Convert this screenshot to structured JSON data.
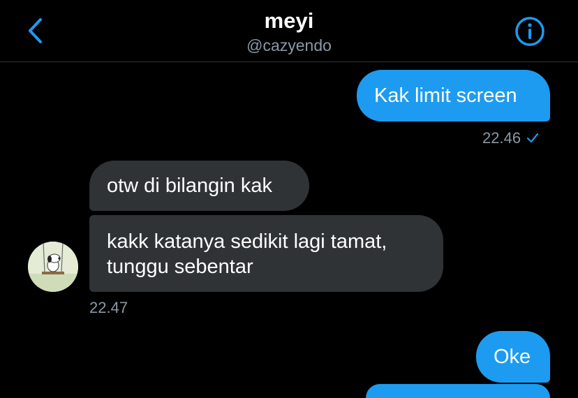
{
  "header": {
    "title": "meyi",
    "handle": "@cazyendo"
  },
  "colors": {
    "background": "#000000",
    "sent_bubble": "#1d9bf0",
    "received_bubble": "#2f3336",
    "accent": "#1d9bf0",
    "muted_text": "#8b98a5"
  },
  "icons": {
    "back": "chevron-left-icon",
    "info": "info-circle-icon",
    "read_receipt": "checkmark-icon"
  },
  "messages": [
    {
      "direction": "sent",
      "text": "Kak limit screen",
      "time": "22.46"
    },
    {
      "direction": "received",
      "text": "otw di bilangin kak"
    },
    {
      "direction": "received",
      "text": "kakk katanya sedikit lagi tamat, tunggu sebentar",
      "time": "22.47"
    },
    {
      "direction": "sent",
      "text": "Oke"
    }
  ]
}
